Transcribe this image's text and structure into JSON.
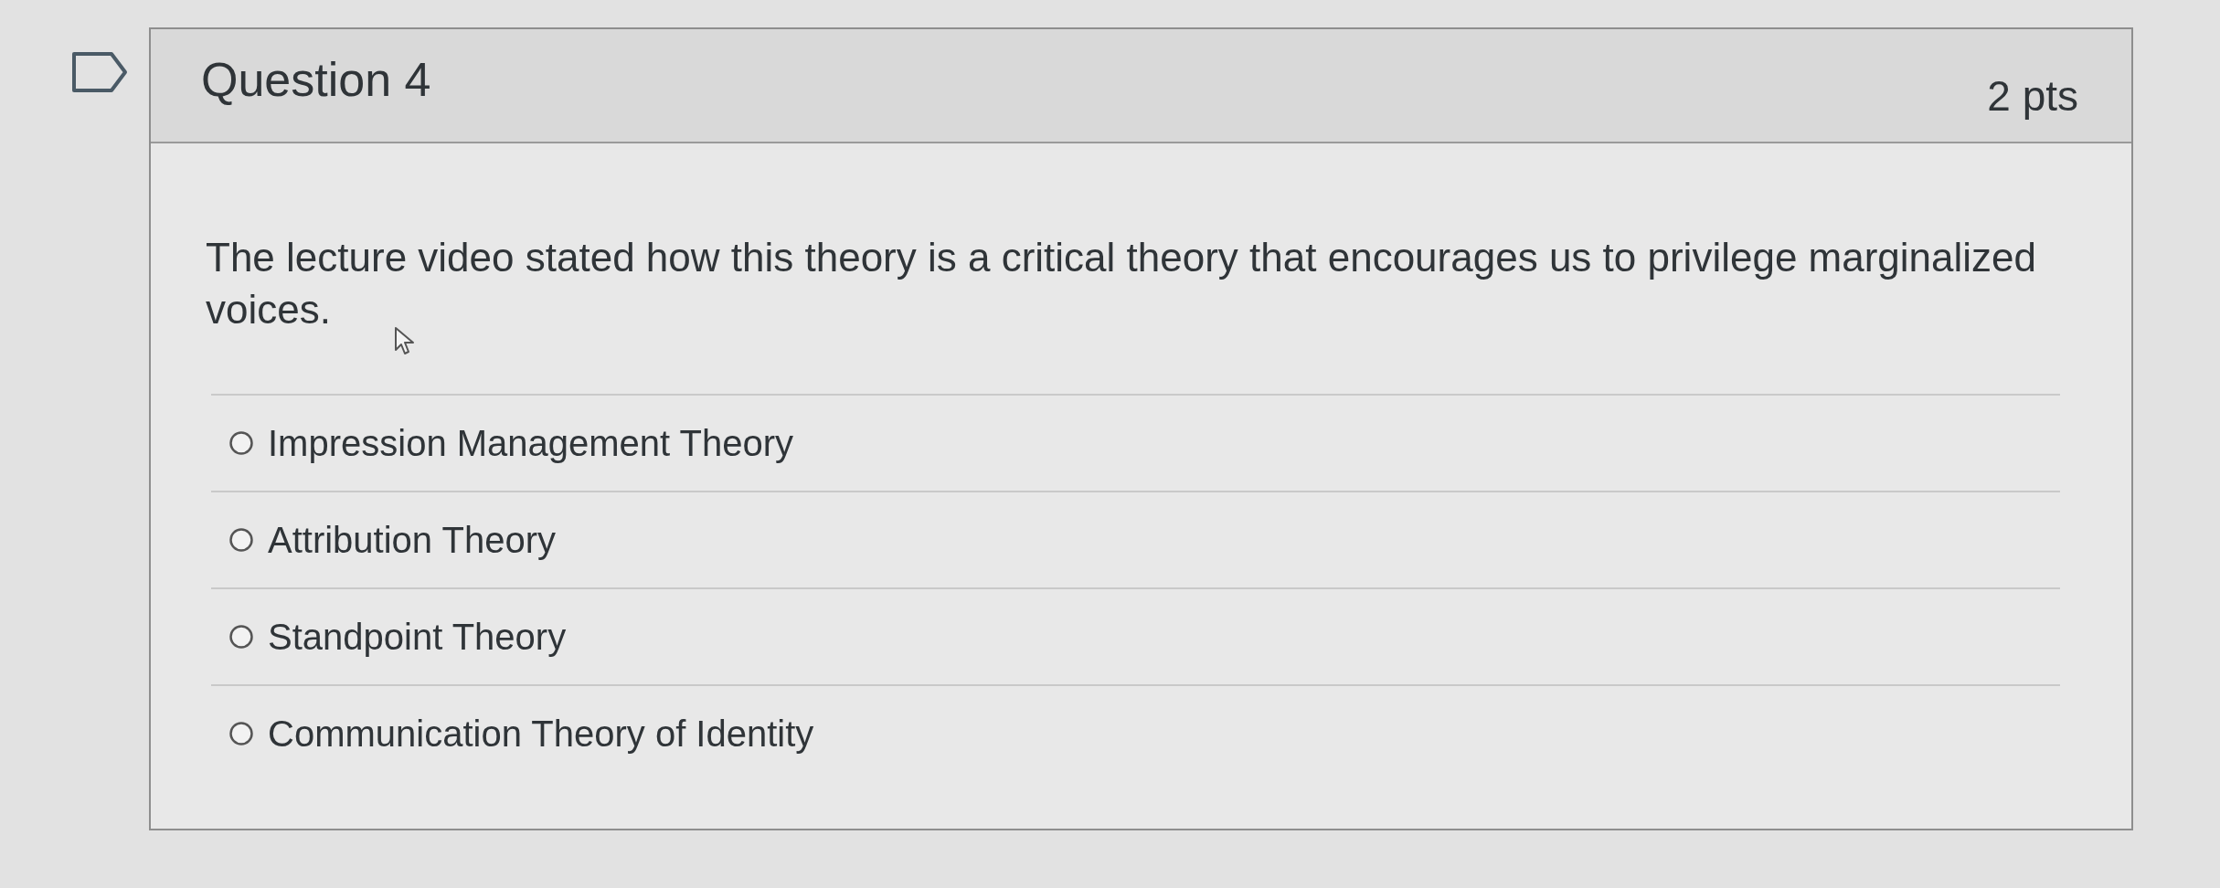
{
  "question": {
    "flagged": false,
    "title": "Question 4",
    "points": "2 pts",
    "text": "The lecture video stated how this theory is a critical theory that encourages us to privilege marginalized voices.",
    "options": [
      {
        "label": "Impression Management Theory",
        "selected": false
      },
      {
        "label": "Attribution Theory",
        "selected": false
      },
      {
        "label": "Standpoint Theory",
        "selected": false
      },
      {
        "label": "Communication Theory of Identity",
        "selected": false
      }
    ]
  }
}
